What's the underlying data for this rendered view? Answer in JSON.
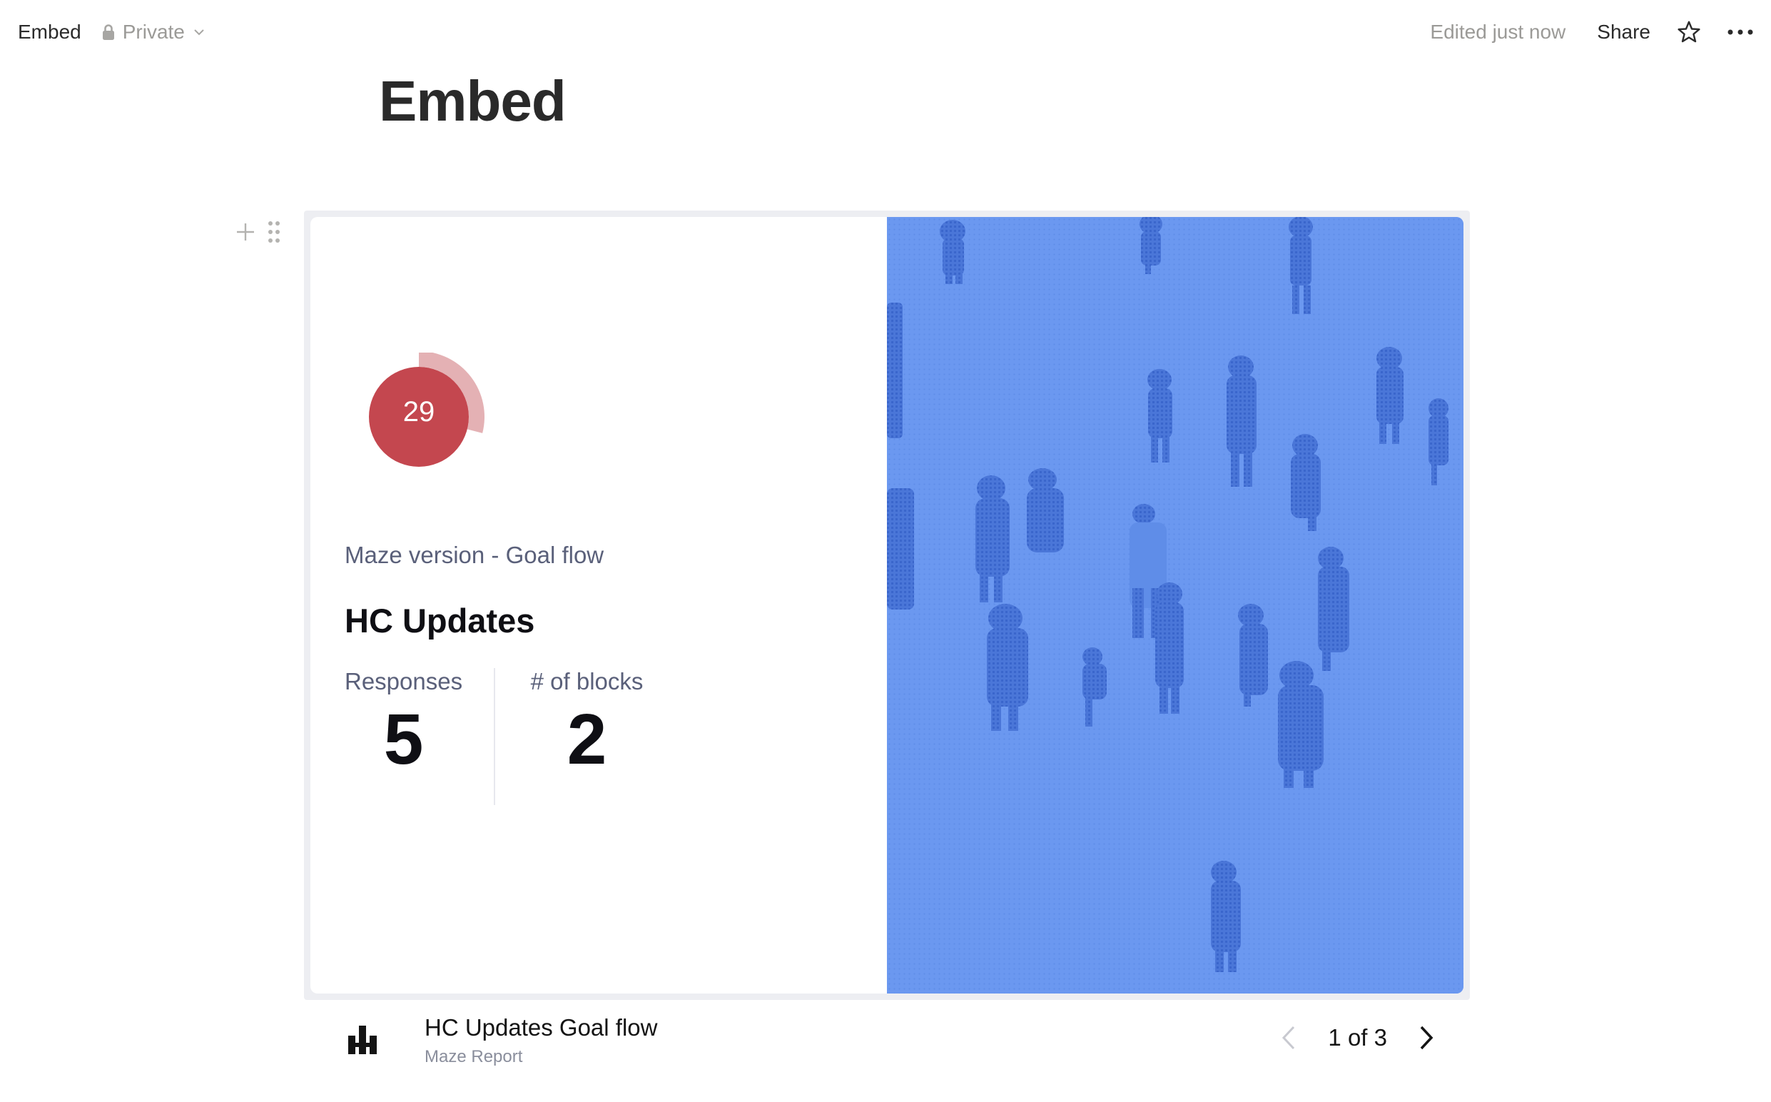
{
  "topbar": {
    "breadcrumb": "Embed",
    "privacy_label": "Private",
    "edited_label": "Edited just now",
    "share_label": "Share"
  },
  "page": {
    "title": "Embed"
  },
  "embed": {
    "score": "29",
    "score_progress": 0.29,
    "colors": {
      "score": "#c4474f",
      "score_track": "#e4b1b4",
      "image_bg": "#6b98f0",
      "figures": "#3a66cc"
    },
    "version_label": "Maze version - Goal flow",
    "card_title": "HC Updates",
    "stats": [
      {
        "label": "Responses",
        "value": "5"
      },
      {
        "label": "# of blocks",
        "value": "2"
      }
    ]
  },
  "footer": {
    "title": "HC Updates Goal flow",
    "subtitle": "Maze Report",
    "pagination": "1 of 3"
  },
  "icons": [
    "lock-icon",
    "chevron-down-icon",
    "star-icon",
    "more-icon",
    "add-block-icon",
    "drag-handle-icon",
    "maze-logo-icon",
    "chevron-left-icon",
    "chevron-right-icon"
  ]
}
